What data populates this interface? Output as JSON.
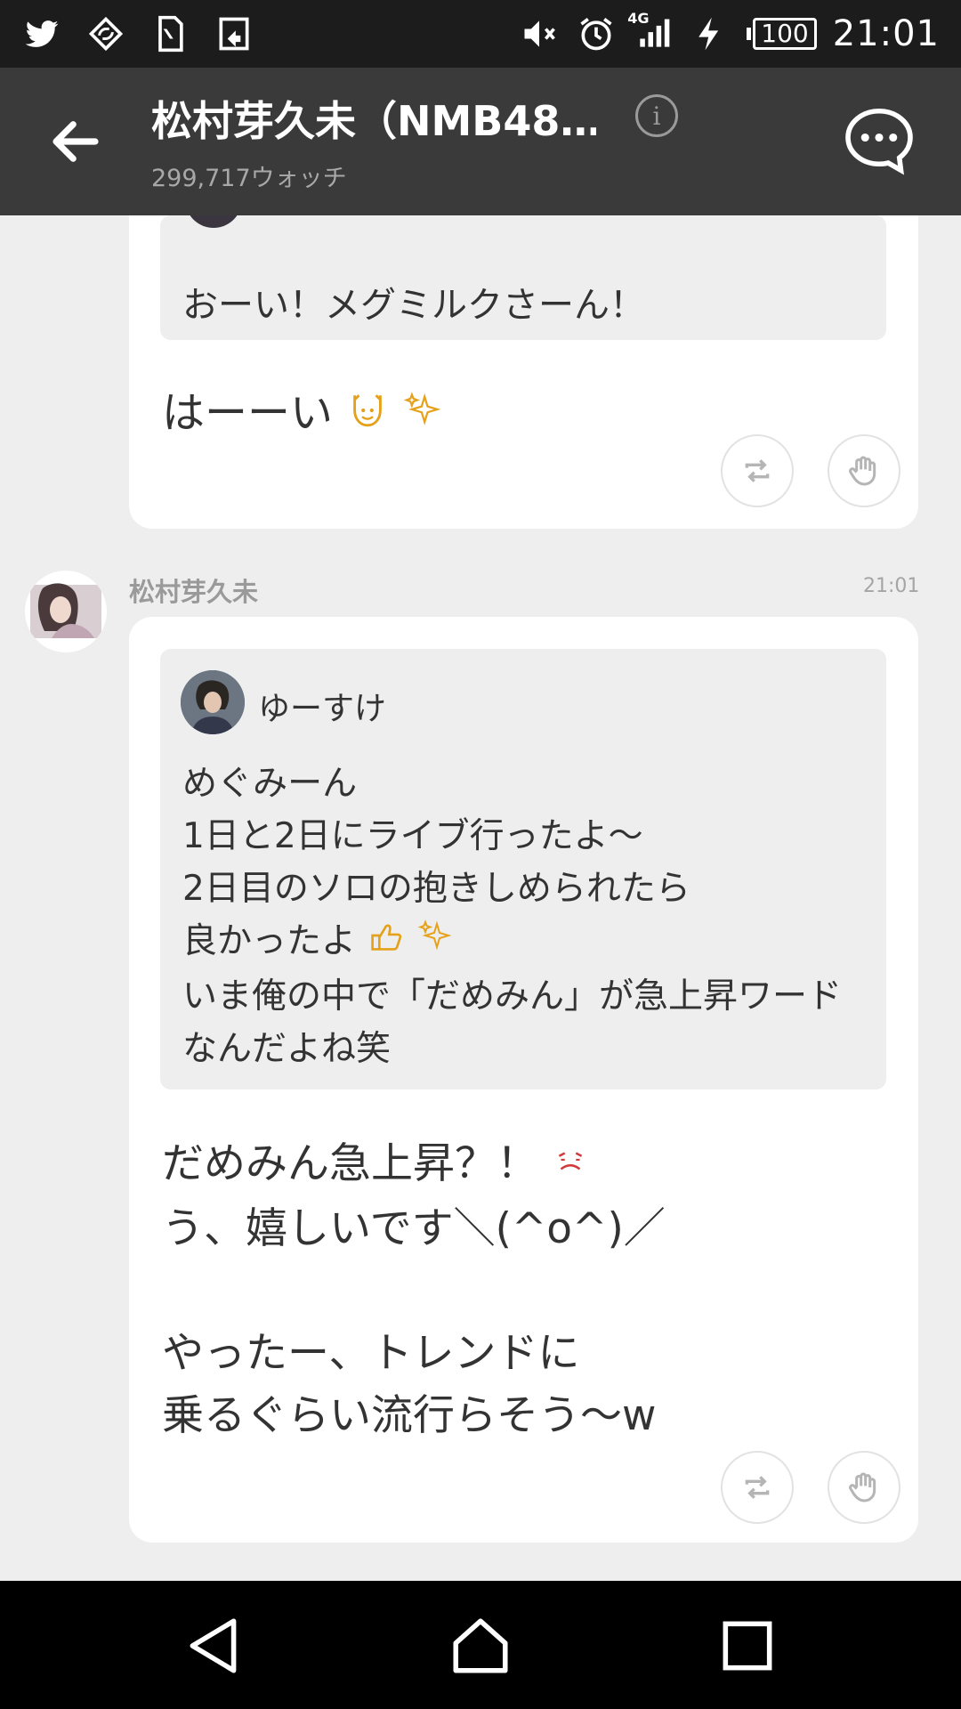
{
  "status_bar": {
    "network": "4G",
    "battery": "100",
    "time": "21:01",
    "icons": [
      "twitter-icon",
      "sync-icon",
      "sim-card-icon",
      "share-icon",
      "mute-icon",
      "alarm-icon",
      "signal-icon",
      "charging-icon"
    ]
  },
  "header": {
    "title": "松村芽久未（NMB48…",
    "watchers": "299,717ウォッチ"
  },
  "messages": [
    {
      "quote_text": "おーい！メグミルクさーん！",
      "reply_text": "はーーい"
    },
    {
      "author": "松村芽久未",
      "time": "21:01",
      "quote_author": "ゆーすけ",
      "quote_lines": [
        "めぐみーん",
        "1日と2日にライブ行ったよ〜",
        "2日目のソロの抱きしめられたら",
        "良かったよ",
        "いま俺の中で「だめみん」が急上昇ワード",
        "なんだよね笑"
      ],
      "reply_lines": [
        "だめみん急上昇？！",
        "う、嬉しいです＼(^o^)／",
        "",
        "やったー、トレンドに",
        "乗るぐらい流行らそう〜w"
      ]
    }
  ],
  "colors": {
    "app_bar": "#3a3a3a",
    "status_bar": "#1c1c1c",
    "background": "#eeeeee",
    "card": "#ffffff",
    "emoji_accent": "#e6a11a"
  }
}
